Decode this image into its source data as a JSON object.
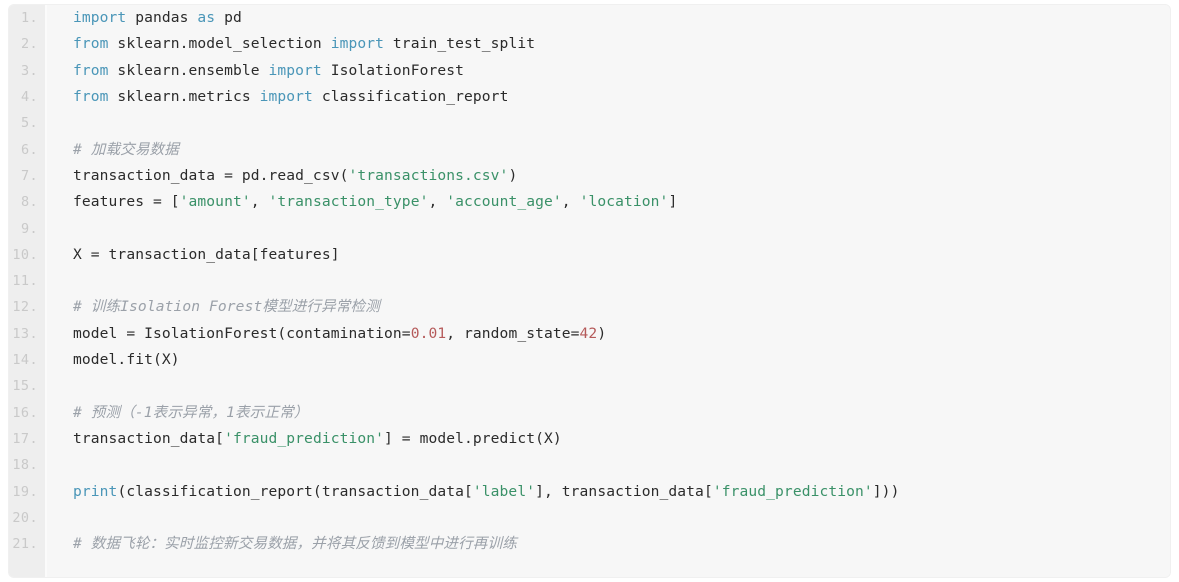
{
  "editor": {
    "language": "python",
    "colors": {
      "background": "#f7f7f7",
      "gutter_background": "#eeeeee",
      "line_number": "#c9c9c9",
      "keyword": "#4a96b8",
      "string": "#3a9168",
      "number": "#b55a5a",
      "comment": "#9ba1a9",
      "text": "#2b2b2b"
    },
    "line_numbers": [
      "1.",
      "2.",
      "3.",
      "4.",
      "5.",
      "6.",
      "7.",
      "8.",
      "9.",
      "10.",
      "11.",
      "12.",
      "13.",
      "14.",
      "15.",
      "16.",
      "17.",
      "18.",
      "19.",
      "20.",
      "21."
    ],
    "lines": [
      {
        "number": "1.",
        "tokens": [
          {
            "t": "import",
            "c": "kw"
          },
          {
            "t": " pandas ",
            "c": "txt"
          },
          {
            "t": "as",
            "c": "kw"
          },
          {
            "t": " pd",
            "c": "txt"
          }
        ]
      },
      {
        "number": "2.",
        "tokens": [
          {
            "t": "from",
            "c": "kw"
          },
          {
            "t": " sklearn.model_selection ",
            "c": "txt"
          },
          {
            "t": "import",
            "c": "kw"
          },
          {
            "t": " train_test_split",
            "c": "txt"
          }
        ]
      },
      {
        "number": "3.",
        "tokens": [
          {
            "t": "from",
            "c": "kw"
          },
          {
            "t": " sklearn.ensemble ",
            "c": "txt"
          },
          {
            "t": "import",
            "c": "kw"
          },
          {
            "t": " IsolationForest",
            "c": "txt"
          }
        ]
      },
      {
        "number": "4.",
        "tokens": [
          {
            "t": "from",
            "c": "kw"
          },
          {
            "t": " sklearn.metrics ",
            "c": "txt"
          },
          {
            "t": "import",
            "c": "kw"
          },
          {
            "t": " classification_report",
            "c": "txt"
          }
        ]
      },
      {
        "number": "5.",
        "tokens": []
      },
      {
        "number": "6.",
        "tokens": [
          {
            "t": "# 加载交易数据",
            "c": "com"
          }
        ]
      },
      {
        "number": "7.",
        "tokens": [
          {
            "t": "transaction_data = pd.read_csv(",
            "c": "txt"
          },
          {
            "t": "'transactions.csv'",
            "c": "str"
          },
          {
            "t": ")",
            "c": "txt"
          }
        ]
      },
      {
        "number": "8.",
        "tokens": [
          {
            "t": "features = [",
            "c": "txt"
          },
          {
            "t": "'amount'",
            "c": "str"
          },
          {
            "t": ", ",
            "c": "txt"
          },
          {
            "t": "'transaction_type'",
            "c": "str"
          },
          {
            "t": ", ",
            "c": "txt"
          },
          {
            "t": "'account_age'",
            "c": "str"
          },
          {
            "t": ", ",
            "c": "txt"
          },
          {
            "t": "'location'",
            "c": "str"
          },
          {
            "t": "]",
            "c": "txt"
          }
        ]
      },
      {
        "number": "9.",
        "tokens": []
      },
      {
        "number": "10.",
        "tokens": [
          {
            "t": "X = transaction_data[features]",
            "c": "txt"
          }
        ]
      },
      {
        "number": "11.",
        "tokens": []
      },
      {
        "number": "12.",
        "tokens": [
          {
            "t": "# 训练Isolation Forest模型进行异常检测",
            "c": "com"
          }
        ]
      },
      {
        "number": "13.",
        "tokens": [
          {
            "t": "model = IsolationForest(contamination=",
            "c": "txt"
          },
          {
            "t": "0.01",
            "c": "num"
          },
          {
            "t": ", random_state=",
            "c": "txt"
          },
          {
            "t": "42",
            "c": "num"
          },
          {
            "t": ")",
            "c": "txt"
          }
        ]
      },
      {
        "number": "14.",
        "tokens": [
          {
            "t": "model.fit(X)",
            "c": "txt"
          }
        ]
      },
      {
        "number": "15.",
        "tokens": []
      },
      {
        "number": "16.",
        "tokens": [
          {
            "t": "# 预测（-1表示异常，1表示正常）",
            "c": "com"
          }
        ]
      },
      {
        "number": "17.",
        "tokens": [
          {
            "t": "transaction_data[",
            "c": "txt"
          },
          {
            "t": "'fraud_prediction'",
            "c": "str"
          },
          {
            "t": "] = model.predict(X)",
            "c": "txt"
          }
        ]
      },
      {
        "number": "18.",
        "tokens": []
      },
      {
        "number": "19.",
        "tokens": [
          {
            "t": "print",
            "c": "kw"
          },
          {
            "t": "(classification_report(transaction_data[",
            "c": "txt"
          },
          {
            "t": "'label'",
            "c": "str"
          },
          {
            "t": "], transaction_data[",
            "c": "txt"
          },
          {
            "t": "'fraud_prediction'",
            "c": "str"
          },
          {
            "t": "]))",
            "c": "txt"
          }
        ]
      },
      {
        "number": "20.",
        "tokens": []
      },
      {
        "number": "21.",
        "tokens": [
          {
            "t": "# 数据飞轮：实时监控新交易数据，并将其反馈到模型中进行再训练",
            "c": "com"
          }
        ]
      }
    ]
  }
}
